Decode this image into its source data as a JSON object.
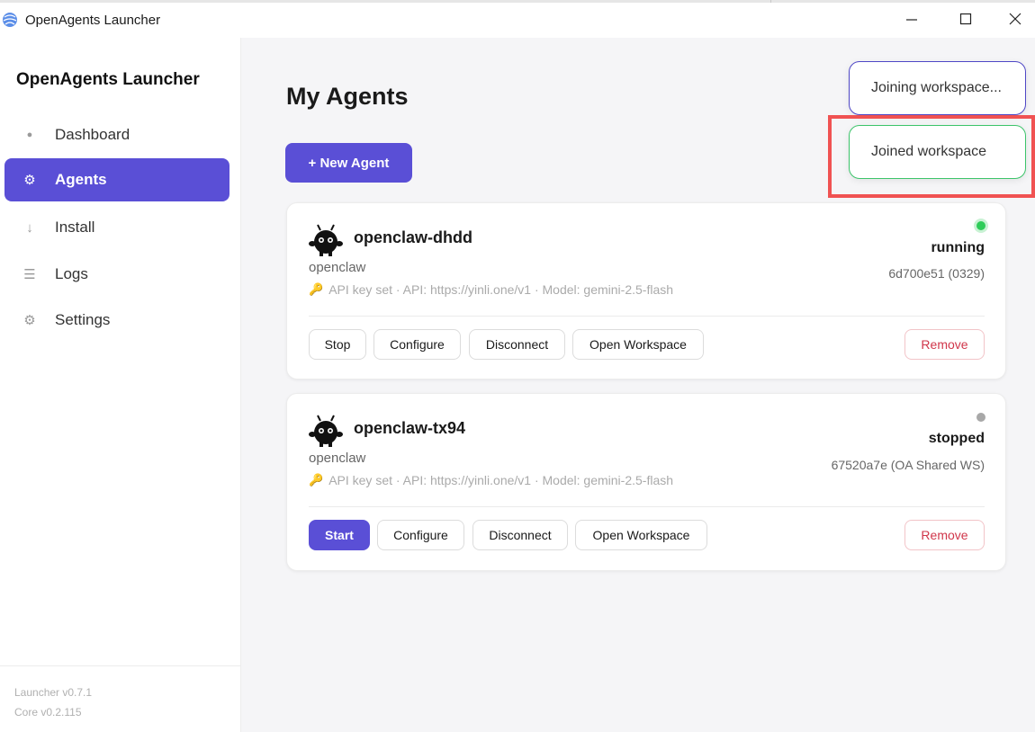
{
  "window": {
    "title": "OpenAgents Launcher"
  },
  "sidebar": {
    "brand": "OpenAgents Launcher",
    "items": [
      {
        "label": "Dashboard",
        "icon": "dot-icon",
        "glyph": "●"
      },
      {
        "label": "Agents",
        "icon": "gear-icon",
        "glyph": "⚙"
      },
      {
        "label": "Install",
        "icon": "arrow-down-icon",
        "glyph": "↓"
      },
      {
        "label": "Logs",
        "icon": "list-icon",
        "glyph": "☰"
      },
      {
        "label": "Settings",
        "icon": "gear-outline-icon",
        "glyph": "⚙"
      }
    ],
    "active_item": "Agents",
    "launcher_version": "Launcher v0.7.1",
    "core_version": "Core v0.2.115"
  },
  "main": {
    "title": "My Agents",
    "new_agent_label": "+ New Agent"
  },
  "agents": [
    {
      "name": "openclaw-dhdd",
      "type": "openclaw",
      "meta": "API key set · API: https://yinli.one/v1 · Model: gemini-2.5-flash",
      "status": "running",
      "status_color": "#2ecc59",
      "workspace": "6d700e51 (0329)",
      "buttons": {
        "toggle": "Stop",
        "configure": "Configure",
        "disconnect": "Disconnect",
        "open_workspace": "Open Workspace",
        "remove": "Remove"
      }
    },
    {
      "name": "openclaw-tx94",
      "type": "openclaw",
      "meta": "API key set · API: https://yinli.one/v1 · Model: gemini-2.5-flash",
      "status": "stopped",
      "status_color": "#a8a8a8",
      "workspace": "67520a7e (OA Shared WS)",
      "buttons": {
        "toggle": "Start",
        "configure": "Configure",
        "disconnect": "Disconnect",
        "open_workspace": "Open Workspace",
        "remove": "Remove"
      }
    }
  ],
  "toasts": {
    "joining": "Joining workspace...",
    "joined": "Joined workspace"
  },
  "colors": {
    "accent": "#5a4fd6",
    "running": "#2ecc59",
    "stopped": "#a8a8a8",
    "danger": "#d0364a",
    "highlight": "#f05252"
  }
}
